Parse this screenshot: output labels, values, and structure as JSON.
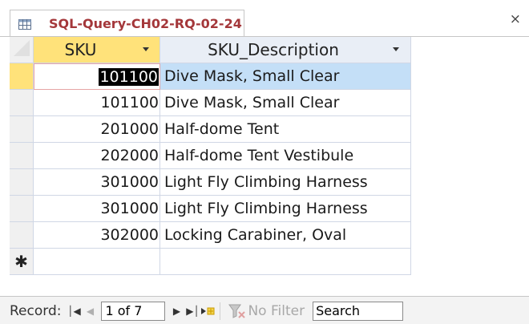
{
  "tab": {
    "title": "SQL-Query-CH02-RQ-02-24",
    "icon": "query-datasheet-icon",
    "close": "×"
  },
  "datasheet": {
    "columns": [
      {
        "label": "SKU"
      },
      {
        "label": "SKU_Description"
      }
    ],
    "rows": [
      {
        "sku": "101100",
        "description": "Dive Mask, Small Clear"
      },
      {
        "sku": "101100",
        "description": "Dive Mask, Small Clear"
      },
      {
        "sku": "201000",
        "description": "Half-dome Tent"
      },
      {
        "sku": "202000",
        "description": "Half-dome Tent Vestibule"
      },
      {
        "sku": "301000",
        "description": "Light Fly Climbing Harness"
      },
      {
        "sku": "301000",
        "description": "Light Fly Climbing Harness"
      },
      {
        "sku": "302000",
        "description": "Locking Carabiner, Oval"
      }
    ],
    "new_row_marker": "✱"
  },
  "navigation": {
    "record_label": "Record:",
    "position": "1 of 7",
    "first_icon": "first-record-icon",
    "prev_icon": "previous-record-icon",
    "next_icon": "next-record-icon",
    "last_icon": "last-record-icon",
    "new_icon": "new-record-icon",
    "filter_label": "No Filter",
    "search_label": "Search"
  },
  "colors": {
    "tab_title": "#a4373a",
    "active_header": "#ffe27a",
    "header": "#e9eef6",
    "selected_cell": "#c4dff7",
    "grid_line": "#d0d7e5"
  }
}
